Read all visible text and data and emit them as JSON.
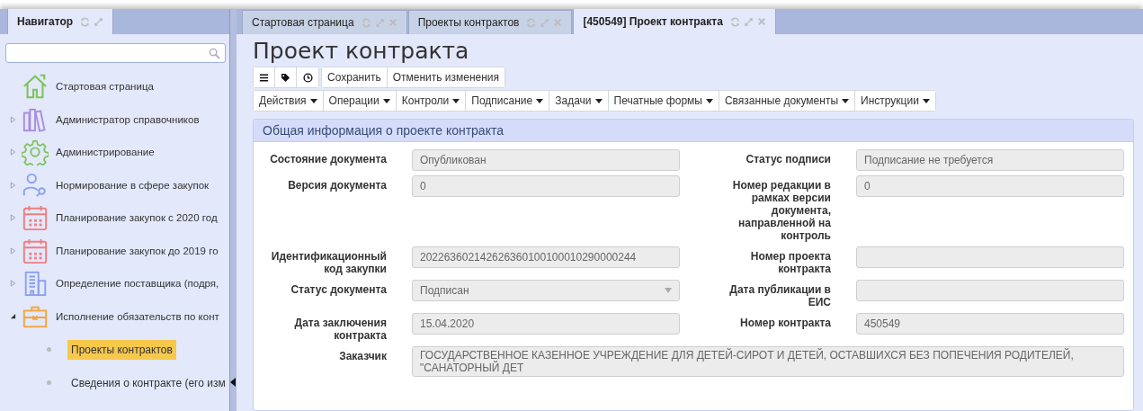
{
  "navigator": {
    "tab": {
      "label": "Навигатор",
      "selected": true
    },
    "items": [
      {
        "label": "Стартовая страница"
      },
      {
        "label": "Администратор справочников",
        "expanded": false
      },
      {
        "label": "Администрирование",
        "expanded": false
      },
      {
        "label": "Нормирование в сфере закупок",
        "expanded": false
      },
      {
        "label": "Планирование закупок с 2020 год",
        "expanded": false
      },
      {
        "label": "Планирование закупок до 2019 го",
        "expanded": false
      },
      {
        "label": "Определение поставщика (подря,",
        "expanded": false
      },
      {
        "label": "Исполнение обязательств по конт",
        "expanded": true,
        "children": [
          {
            "label": "Проекты контрактов",
            "selected": true
          },
          {
            "label": "Сведения о контракте (его изм",
            "selected": false
          }
        ]
      }
    ]
  },
  "tabs": [
    {
      "label": "Стартовая страница",
      "selected": false
    },
    {
      "label": "Проекты контрактов",
      "selected": false
    },
    {
      "label": "[450549] Проект контракта",
      "selected": true
    }
  ],
  "page_title": "Проект контракта",
  "toolbar": {
    "buttons": [
      "Сохранить",
      "Отменить изменения"
    ]
  },
  "menus": [
    "Действия",
    "Операции",
    "Контроли",
    "Подписание",
    "Задачи",
    "Печатные формы",
    "Связанные документы",
    "Инструкции"
  ],
  "section": {
    "title": "Общая информация о проекте контракта",
    "rows": [
      {
        "cells": [
          {
            "label": "Состояние документа",
            "value": "Опубликован",
            "kind": "text"
          },
          {
            "label": "Статус подписи",
            "value": "Подписание не требуется",
            "kind": "text"
          }
        ]
      },
      {
        "cells": [
          {
            "label": "Версия документа",
            "value": "0",
            "kind": "text"
          },
          {
            "label": "Номер редакции в рамках версии документа, направленной на контроль",
            "value": "0",
            "kind": "text"
          }
        ]
      },
      {
        "cells": [
          {
            "label": "Идентификационный код закупки",
            "value": "202263602142626360100100010290000244",
            "kind": "text"
          },
          {
            "label": "Номер проекта контракта",
            "kind": "text"
          }
        ]
      },
      {
        "cells": [
          {
            "label": "Статус документа",
            "value": "Подписан",
            "kind": "select"
          },
          {
            "label": "Дата публикации в ЕИС",
            "kind": "text"
          }
        ]
      },
      {
        "cells": [
          {
            "label": "Дата заключения контракта",
            "value": "15.04.2020",
            "kind": "text"
          },
          {
            "label": "Номер контракта",
            "value": "450549",
            "kind": "text"
          }
        ]
      },
      {
        "cells": [
          {
            "label": "Заказчик",
            "value": "ГОСУДАРСТВЕННОЕ КАЗЕННОЕ УЧРЕЖДЕНИЕ ДЛЯ ДЕТЕЙ-СИРОТ И ДЕТЕЙ, ОСТАВШИХСЯ БЕЗ ПОПЕЧЕНИЯ РОДИТЕЛЕЙ, \"САНАТОРНЫЙ ДЕТ",
            "kind": "text"
          }
        ]
      }
    ]
  }
}
